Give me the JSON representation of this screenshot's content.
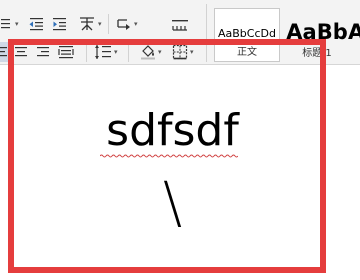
{
  "styles": {
    "items": [
      {
        "sample": "AaBbCcDd",
        "name": "正文"
      },
      {
        "sample": "AaBb",
        "name": "标题 1"
      },
      {
        "sample": "A",
        "name": ""
      }
    ]
  },
  "document": {
    "line1": "sdfsdf",
    "line2": "\\"
  },
  "colors": {
    "highlight_border": "#e53d3d",
    "spellcheck_underline": "#d04040"
  },
  "toolbar": {
    "icons": [
      "bullets-list-icon",
      "decrease-indent-icon",
      "increase-indent-icon",
      "chinese-layout-icon",
      "sort-icon",
      "show-formatting-marks-icon",
      "align-left-icon",
      "align-center-icon",
      "align-right-icon",
      "distributed-align-icon",
      "line-spacing-icon",
      "shading-icon",
      "borders-icon"
    ]
  }
}
